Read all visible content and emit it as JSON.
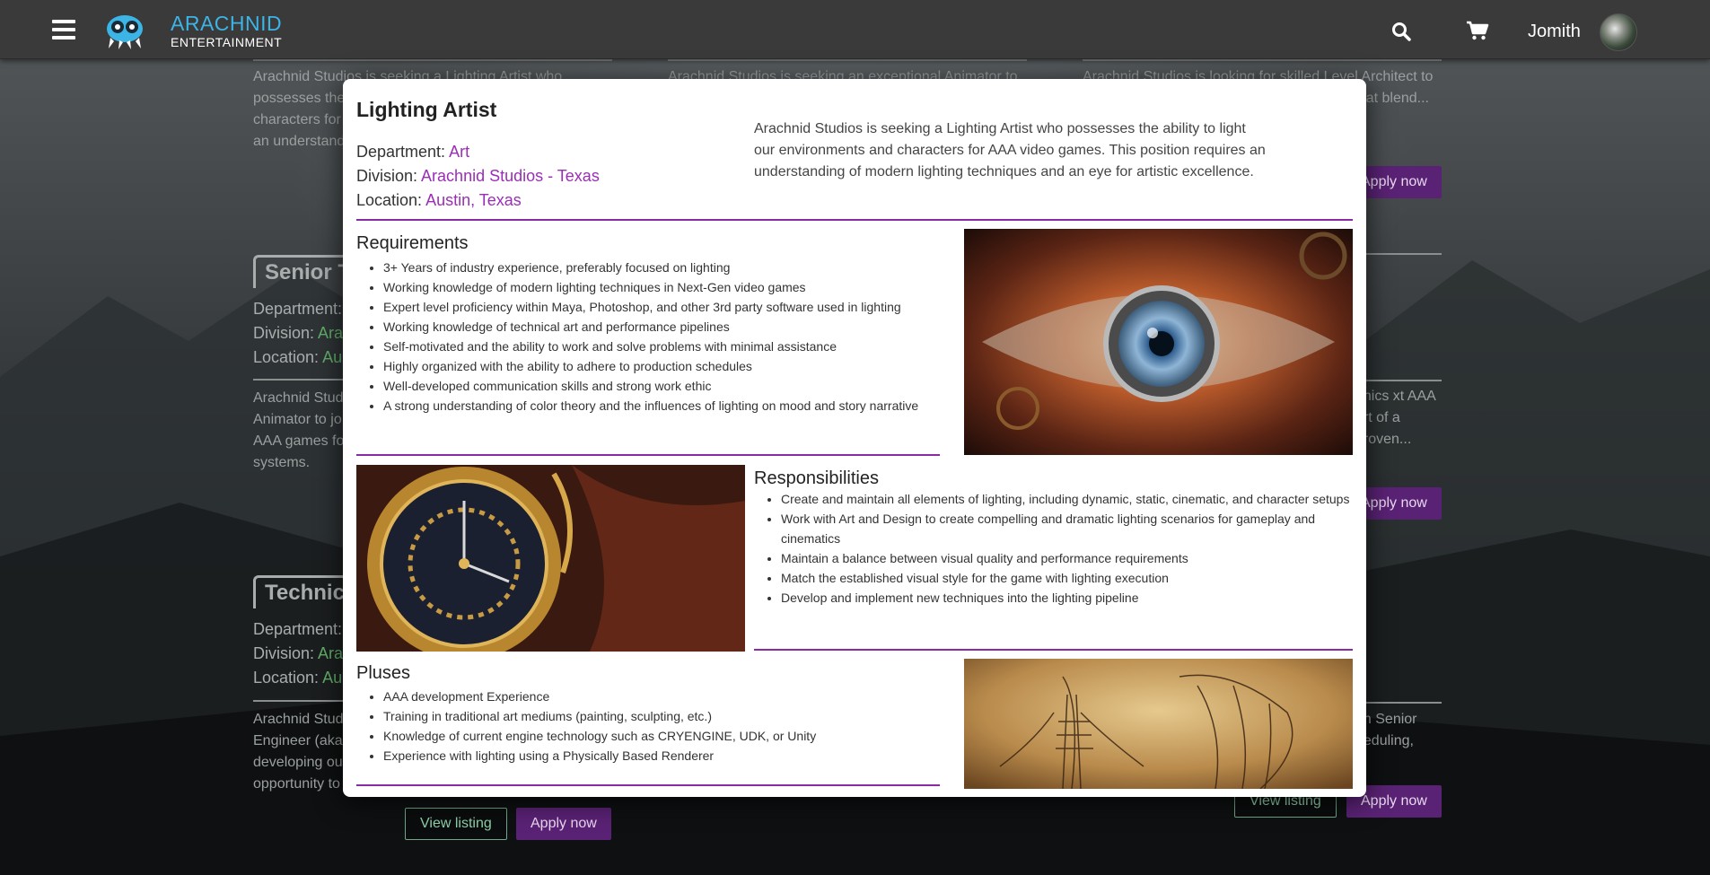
{
  "header": {
    "logo_line1": "ARACHNID",
    "logo_line2": "ENTERTAINMENT",
    "username": "Jomith",
    "accent": "#3cb4e6"
  },
  "background_cards": {
    "card1": {
      "desc": "Arachnid Studios is seeking a Lighting Artist who possesses the ability to light our environments and characters for AAA video games. This position requires an understanding"
    },
    "card2": {
      "desc": "Arachnid Studios is seeking an exceptional Animator to"
    },
    "card3": {
      "desc": "Arachnid Studios is looking for skilled Level Architect to design levels for PC and work closely with that blend...",
      "apply": "Apply now"
    },
    "card4": {
      "title": "Senior T",
      "dept_label": "Department:",
      "div_label": "Division:",
      "div_value": "Ara",
      "loc_label": "Location:",
      "loc_value": "Au",
      "desc": "Arachnid Studi Animator to jo AAA games fo systems."
    },
    "card5": {
      "desc": "phics xt AAA art of a proven...",
      "apply": "Apply now"
    },
    "card6": {
      "title": "Technica",
      "dept_label": "Department:",
      "div_label": "Division:",
      "div_value": "Ara",
      "loc_label": "Location:",
      "loc_value": "Au",
      "desc": "Arachnid Stud Engineer (aka, developing ou opportunity to",
      "view": "View listing",
      "apply": "Apply now"
    },
    "card7": {
      "desc": "an Senior heduling,",
      "view": "View listing",
      "apply": "Apply now"
    }
  },
  "modal": {
    "title": "Lighting Artist",
    "department_label": "Department:",
    "department_value": "Art",
    "division_label": "Division:",
    "division_value": "Arachnid Studios - Texas",
    "location_label": "Location:",
    "location_value": "Austin, Texas",
    "summary": "Arachnid Studios is seeking a Lighting Artist who possesses the ability to light our environments and characters for AAA video games. This position requires an understanding of modern lighting techniques and an eye for artistic excellence.",
    "requirements_title": "Requirements",
    "requirements": [
      "3+ Years of industry experience, preferably focused on lighting",
      "Working knowledge of modern lighting techniques in Next-Gen video games",
      "Expert level proficiency within Maya, Photoshop, and other 3rd party software used in lighting",
      "Working knowledge of technical art and performance pipelines",
      "Self-motivated and the ability to work and solve problems with minimal assistance",
      "Highly organized with the ability to adhere to production schedules",
      "Well-developed communication skills and strong work ethic",
      "A strong understanding of color theory and the influences of lighting on mood and story narrative"
    ],
    "responsibilities_title": "Responsibilities",
    "responsibilities": [
      "Create and maintain all elements of lighting, including dynamic, static, cinematic, and character setups",
      "Work with Art and Design to create compelling and dramatic lighting scenarios for gameplay and cinematics",
      "Maintain a balance between visual quality and performance requirements",
      "Match the established visual style for the game with lighting execution",
      "Develop and implement new techniques into the lighting pipeline"
    ],
    "pluses_title": "Pluses",
    "pluses": [
      "AAA development Experience",
      "Training in traditional art mediums (painting, sculpting, etc.)",
      "Knowledge of current engine technology such as CRYENGINE, UDK, or Unity",
      "Experience with lighting using a Physically Based Renderer"
    ],
    "accent": "#9a2fb5"
  },
  "bottom_buttons": {
    "view": "View listing",
    "apply": "Apply now"
  }
}
